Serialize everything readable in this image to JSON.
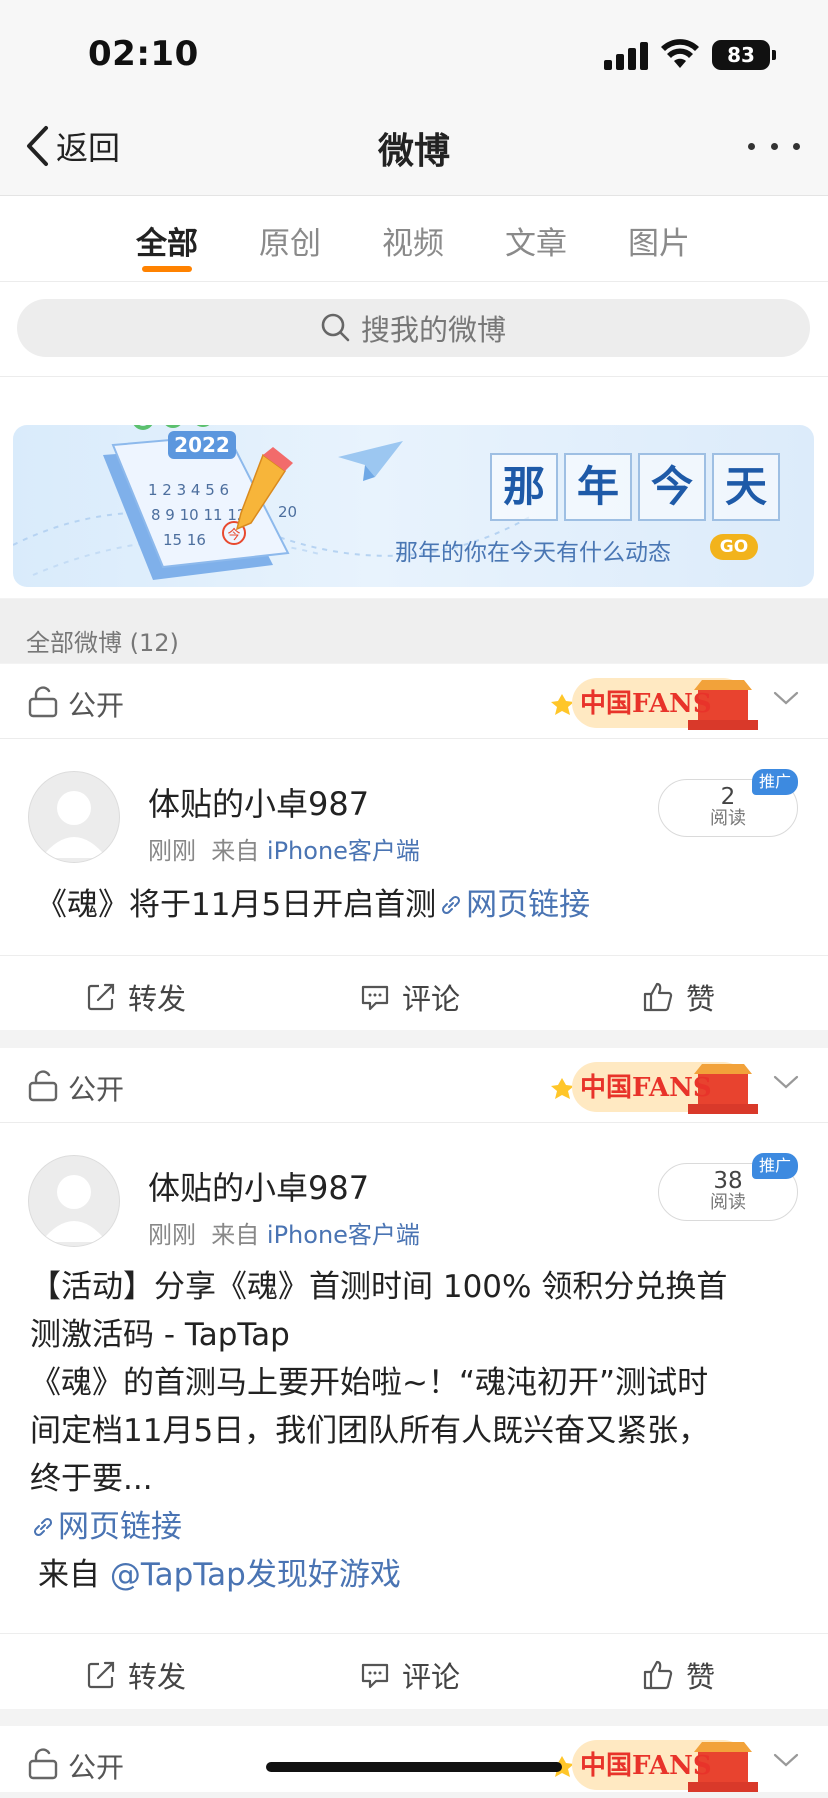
{
  "status_bar": {
    "time": "02:10",
    "battery": "83"
  },
  "nav": {
    "back_label": "返回",
    "title": "微博"
  },
  "tabs": [
    {
      "label": "全部",
      "active": true
    },
    {
      "label": "原创"
    },
    {
      "label": "视频"
    },
    {
      "label": "文章"
    },
    {
      "label": "图片"
    }
  ],
  "search": {
    "placeholder": "搜我的微博"
  },
  "banner": {
    "title_chars": [
      "那",
      "年",
      "今",
      "天"
    ],
    "subtitle": "那年的你在今天有什么动态",
    "go_label": "GO",
    "calendar_year": "2022",
    "calendar_today_mark": "今"
  },
  "section": {
    "title": "全部微博 (12)"
  },
  "posts": [
    {
      "privacy": "公开",
      "badge_text": "中国FANS",
      "username": "体贴的小卓987",
      "time": "刚刚",
      "source_prefix": "来自",
      "source": "iPhone客户端",
      "read_count": "2",
      "read_label": "阅读",
      "promo_tag": "推广",
      "text": "《魂》将于11月5日开启首测",
      "link_label": "网页链接",
      "actions": {
        "repost": "转发",
        "comment": "评论",
        "like": "赞"
      }
    },
    {
      "privacy": "公开",
      "badge_text": "中国FANS",
      "username": "体贴的小卓987",
      "time": "刚刚",
      "source_prefix": "来自",
      "source": "iPhone客户端",
      "read_count": "38",
      "read_label": "阅读",
      "promo_tag": "推广",
      "text_line1": "【活动】分享《魂》首测时间 100% 领积分兑换首",
      "text_line2": "测激活码 - TapTap",
      "text_line3": "《魂》的首测马上要开始啦~！“魂沌初开”测试时",
      "text_line4": "间定档11月5日，我们团队所有人既兴奋又紧张，",
      "text_line5": "终于要...",
      "link_label": "网页链接",
      "from_prefix": "来自",
      "from_mention": "@TapTap发现好游戏",
      "actions": {
        "repost": "转发",
        "comment": "评论",
        "like": "赞"
      }
    },
    {
      "privacy": "公开",
      "badge_text": "中国FANS"
    }
  ]
}
